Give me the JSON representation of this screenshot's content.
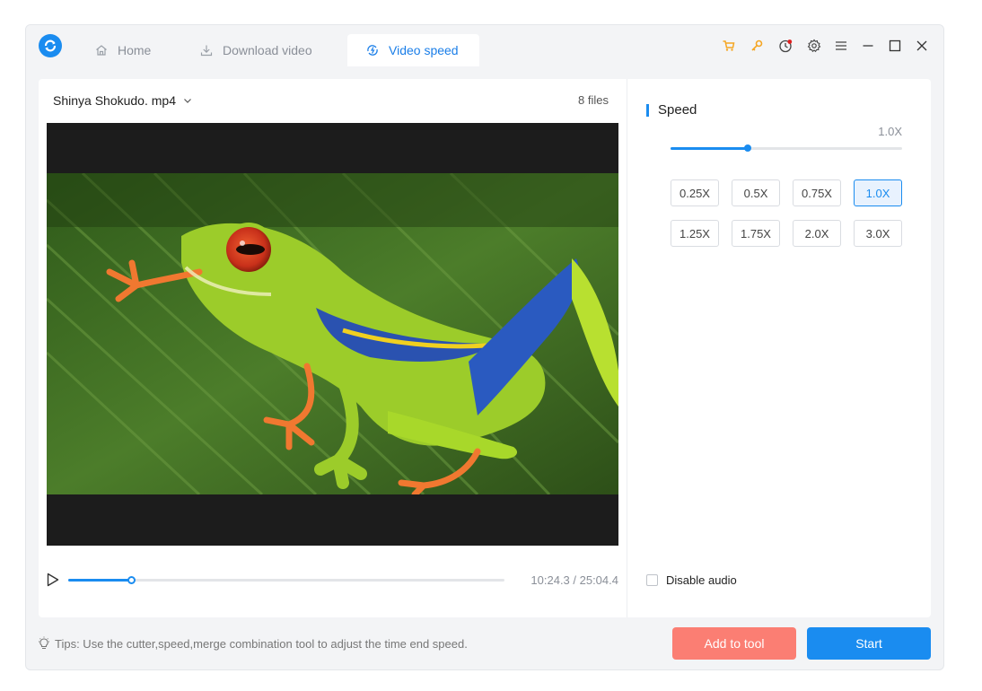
{
  "colors": {
    "accent": "#1a8cf0",
    "add_button": "#fb7e73",
    "cart_icon": "#f5a623",
    "key_icon": "#f5a623",
    "notification_dot": "#e02020"
  },
  "tabs": [
    {
      "label": "Home",
      "icon": "home-icon",
      "active": false
    },
    {
      "label": "Download video",
      "icon": "download-icon",
      "active": false
    },
    {
      "label": "Video speed",
      "icon": "speed-icon",
      "active": true
    }
  ],
  "window_controls": [
    "cart-icon",
    "key-icon",
    "clock-icon",
    "gear-icon",
    "menu-icon",
    "minimize-icon",
    "maximize-icon",
    "close-icon"
  ],
  "file": {
    "name": "Shinya Shokudo. mp4",
    "count": "8 files"
  },
  "player": {
    "time": "10:24.3 / 25:04.4",
    "progress": 0.144
  },
  "speed": {
    "title": "Speed",
    "current": "1.0X",
    "slider_level": 0.333,
    "options": [
      "0.25X",
      "0.5X",
      "0.75X",
      "1.0X",
      "1.25X",
      "1.75X",
      "2.0X",
      "3.0X"
    ],
    "selected": "1.0X"
  },
  "audio": {
    "label": "Disable audio",
    "checked": false
  },
  "footer": {
    "tips": "Tips: Use the cutter,speed,merge combination tool to adjust the time end speed.",
    "add_label": "Add to tool",
    "start_label": "Start"
  }
}
